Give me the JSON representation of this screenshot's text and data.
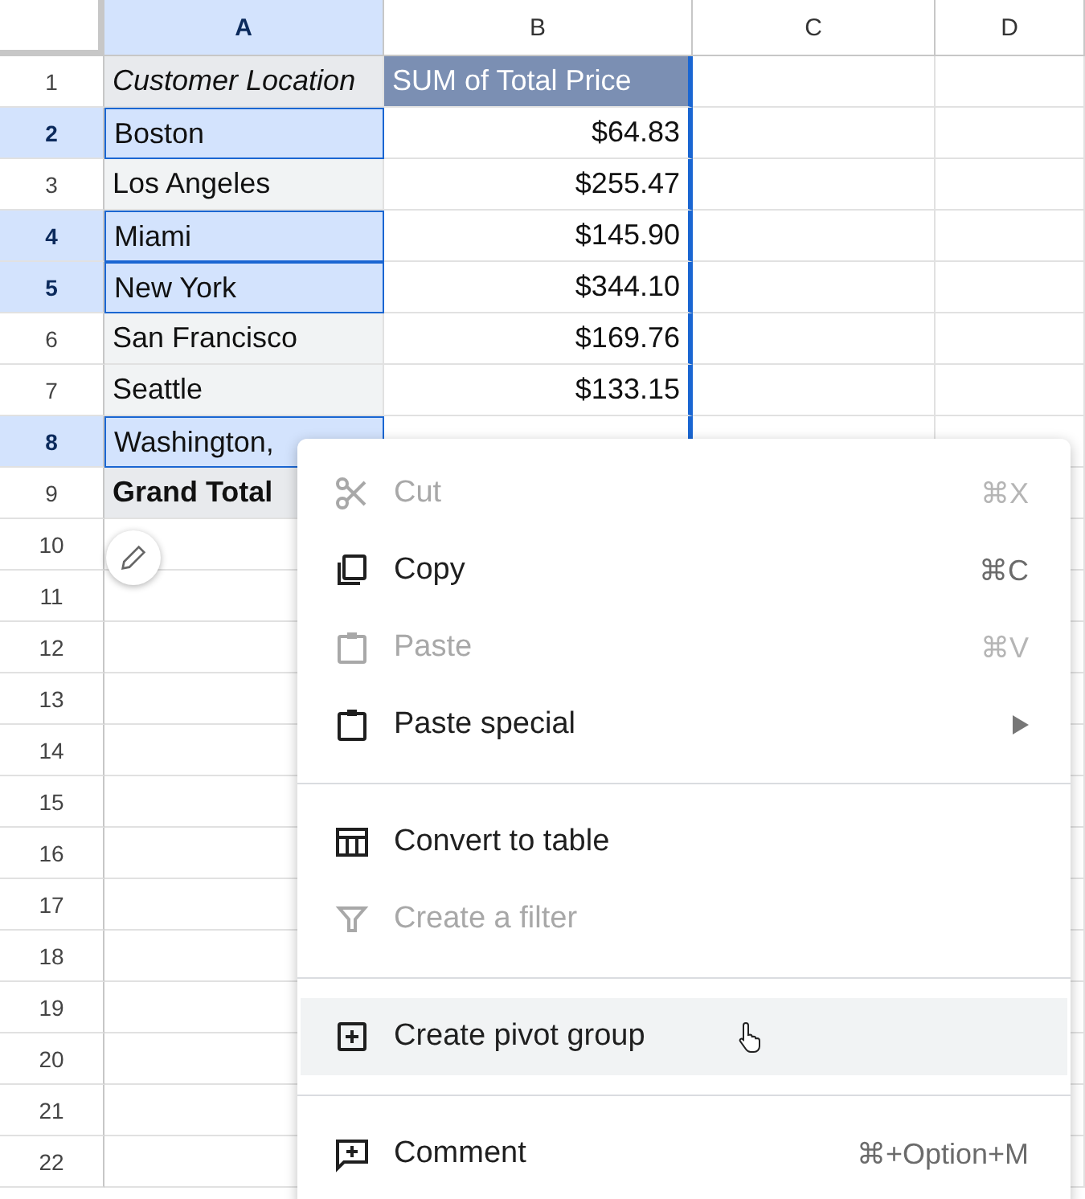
{
  "columns": [
    {
      "label": "A",
      "selected": true
    },
    {
      "label": "B",
      "selected": false
    },
    {
      "label": "C",
      "selected": false
    },
    {
      "label": "D",
      "selected": false
    }
  ],
  "rows": [
    {
      "number": "1",
      "kind": "header",
      "selected": false,
      "cells": [
        "Customer Location",
        "SUM of Total Price"
      ]
    },
    {
      "number": "2",
      "kind": "data",
      "selected": true,
      "cells": [
        "Boston",
        "$64.83"
      ]
    },
    {
      "number": "3",
      "kind": "data",
      "selected": false,
      "cells": [
        "Los Angeles",
        "$255.47"
      ]
    },
    {
      "number": "4",
      "kind": "data",
      "selected": true,
      "cells": [
        "Miami",
        "$145.90"
      ]
    },
    {
      "number": "5",
      "kind": "data",
      "selected": true,
      "cells": [
        "New York",
        "$344.10"
      ]
    },
    {
      "number": "6",
      "kind": "data",
      "selected": false,
      "cells": [
        "San Francisco",
        "$169.76"
      ]
    },
    {
      "number": "7",
      "kind": "data",
      "selected": false,
      "cells": [
        "Seattle",
        "$133.15"
      ]
    },
    {
      "number": "8",
      "kind": "data",
      "selected": true,
      "cells": [
        "Washington,"
      ]
    },
    {
      "number": "9",
      "kind": "total",
      "selected": false,
      "cells": [
        "Grand Total"
      ]
    },
    {
      "number": "10",
      "kind": "empty",
      "selected": false,
      "cells": []
    },
    {
      "number": "11",
      "kind": "empty",
      "selected": false,
      "cells": []
    },
    {
      "number": "12",
      "kind": "empty",
      "selected": false,
      "cells": []
    },
    {
      "number": "13",
      "kind": "empty",
      "selected": false,
      "cells": []
    },
    {
      "number": "14",
      "kind": "empty",
      "selected": false,
      "cells": []
    },
    {
      "number": "15",
      "kind": "empty",
      "selected": false,
      "cells": []
    },
    {
      "number": "16",
      "kind": "empty",
      "selected": false,
      "cells": []
    },
    {
      "number": "17",
      "kind": "empty",
      "selected": false,
      "cells": []
    },
    {
      "number": "18",
      "kind": "empty",
      "selected": false,
      "cells": []
    },
    {
      "number": "19",
      "kind": "empty",
      "selected": false,
      "cells": []
    },
    {
      "number": "20",
      "kind": "empty",
      "selected": false,
      "cells": []
    },
    {
      "number": "21",
      "kind": "empty",
      "selected": false,
      "cells": []
    },
    {
      "number": "22",
      "kind": "empty",
      "selected": false,
      "cells": []
    }
  ],
  "context_menu": {
    "items": [
      {
        "kind": "item",
        "label": "Cut",
        "shortcut": "⌘X",
        "disabled": true,
        "highlighted": false,
        "submenu": false
      },
      {
        "kind": "item",
        "label": "Copy",
        "shortcut": "⌘C",
        "disabled": false,
        "highlighted": false,
        "submenu": false
      },
      {
        "kind": "item",
        "label": "Paste",
        "shortcut": "⌘V",
        "disabled": true,
        "highlighted": false,
        "submenu": false
      },
      {
        "kind": "item",
        "label": "Paste special",
        "disabled": false,
        "highlighted": false,
        "submenu": true
      },
      {
        "kind": "divider"
      },
      {
        "kind": "item",
        "label": "Convert to table",
        "disabled": false,
        "highlighted": false,
        "submenu": false
      },
      {
        "kind": "item",
        "label": "Create a filter",
        "disabled": true,
        "highlighted": false,
        "submenu": false
      },
      {
        "kind": "divider"
      },
      {
        "kind": "item",
        "label": "Create pivot group",
        "disabled": false,
        "highlighted": true,
        "submenu": false
      },
      {
        "kind": "divider"
      },
      {
        "kind": "item",
        "label": "Comment",
        "shortcut": "⌘+Option+M",
        "disabled": false,
        "highlighted": false,
        "submenu": false
      }
    ]
  }
}
